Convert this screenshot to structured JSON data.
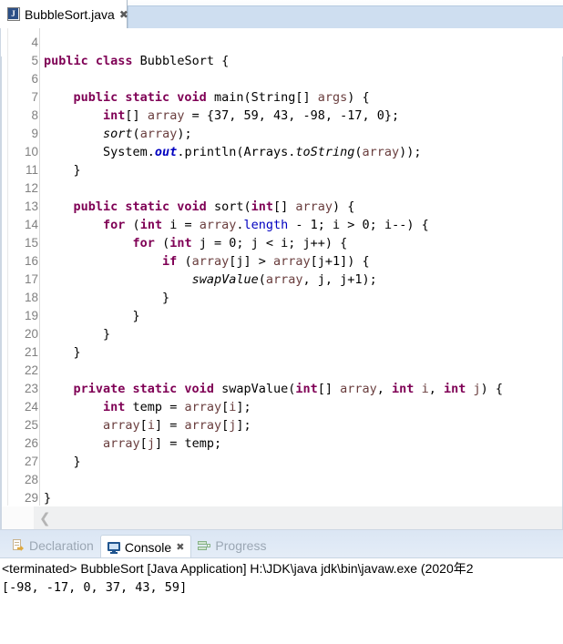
{
  "editor": {
    "tab": {
      "title": "BubbleSort.java",
      "close_glyph": "✖",
      "icon": "java-file-icon",
      "badge": "J"
    },
    "first_line_number": 4,
    "lines": [
      {
        "n": 4,
        "fold": false,
        "tokens": []
      },
      {
        "n": 5,
        "fold": false,
        "tokens": [
          {
            "t": "kw",
            "s": "public class"
          },
          {
            "t": "plain",
            "s": " BubbleSort {"
          }
        ]
      },
      {
        "n": 6,
        "fold": false,
        "tokens": []
      },
      {
        "n": 7,
        "fold": true,
        "tokens": [
          {
            "t": "plain",
            "s": "    "
          },
          {
            "t": "kw",
            "s": "public static void"
          },
          {
            "t": "plain",
            "s": " main(String[] "
          },
          {
            "t": "prm",
            "s": "args"
          },
          {
            "t": "plain",
            "s": ") {"
          }
        ]
      },
      {
        "n": 8,
        "fold": false,
        "tokens": [
          {
            "t": "plain",
            "s": "        "
          },
          {
            "t": "kw",
            "s": "int"
          },
          {
            "t": "plain",
            "s": "[] "
          },
          {
            "t": "prm",
            "s": "array"
          },
          {
            "t": "plain",
            "s": " = {37, 59, 43, -98, -17, 0};"
          }
        ]
      },
      {
        "n": 9,
        "fold": false,
        "tokens": [
          {
            "t": "plain",
            "s": "        "
          },
          {
            "t": "sm",
            "s": "sort"
          },
          {
            "t": "plain",
            "s": "("
          },
          {
            "t": "prm",
            "s": "array"
          },
          {
            "t": "plain",
            "s": ");"
          }
        ]
      },
      {
        "n": 10,
        "fold": false,
        "tokens": [
          {
            "t": "plain",
            "s": "        System."
          },
          {
            "t": "stat",
            "s": "out"
          },
          {
            "t": "plain",
            "s": ".println(Arrays."
          },
          {
            "t": "sm",
            "s": "toString"
          },
          {
            "t": "plain",
            "s": "("
          },
          {
            "t": "prm",
            "s": "array"
          },
          {
            "t": "plain",
            "s": "));"
          }
        ]
      },
      {
        "n": 11,
        "fold": false,
        "tokens": [
          {
            "t": "plain",
            "s": "    }"
          }
        ]
      },
      {
        "n": 12,
        "fold": false,
        "tokens": []
      },
      {
        "n": 13,
        "fold": true,
        "tokens": [
          {
            "t": "plain",
            "s": "    "
          },
          {
            "t": "kw",
            "s": "public static void"
          },
          {
            "t": "plain",
            "s": " sort("
          },
          {
            "t": "kw",
            "s": "int"
          },
          {
            "t": "plain",
            "s": "[] "
          },
          {
            "t": "prm",
            "s": "array"
          },
          {
            "t": "plain",
            "s": ") {"
          }
        ]
      },
      {
        "n": 14,
        "fold": false,
        "tokens": [
          {
            "t": "plain",
            "s": "        "
          },
          {
            "t": "kw",
            "s": "for"
          },
          {
            "t": "plain",
            "s": " ("
          },
          {
            "t": "kw",
            "s": "int"
          },
          {
            "t": "plain",
            "s": " i = "
          },
          {
            "t": "prm",
            "s": "array"
          },
          {
            "t": "plain",
            "s": "."
          },
          {
            "t": "fld",
            "s": "length"
          },
          {
            "t": "plain",
            "s": " - 1; i > 0; i--) {"
          }
        ]
      },
      {
        "n": 15,
        "fold": false,
        "tokens": [
          {
            "t": "plain",
            "s": "            "
          },
          {
            "t": "kw",
            "s": "for"
          },
          {
            "t": "plain",
            "s": " ("
          },
          {
            "t": "kw",
            "s": "int"
          },
          {
            "t": "plain",
            "s": " j = 0; j < i; j++) {"
          }
        ]
      },
      {
        "n": 16,
        "fold": false,
        "tokens": [
          {
            "t": "plain",
            "s": "                "
          },
          {
            "t": "kw",
            "s": "if"
          },
          {
            "t": "plain",
            "s": " ("
          },
          {
            "t": "prm",
            "s": "array"
          },
          {
            "t": "plain",
            "s": "[j] > "
          },
          {
            "t": "prm",
            "s": "array"
          },
          {
            "t": "plain",
            "s": "[j+1]) {"
          }
        ]
      },
      {
        "n": 17,
        "fold": false,
        "tokens": [
          {
            "t": "plain",
            "s": "                    "
          },
          {
            "t": "sm",
            "s": "swapValue"
          },
          {
            "t": "plain",
            "s": "("
          },
          {
            "t": "prm",
            "s": "array"
          },
          {
            "t": "plain",
            "s": ", j, j+1);"
          }
        ]
      },
      {
        "n": 18,
        "fold": false,
        "tokens": [
          {
            "t": "plain",
            "s": "                }"
          }
        ]
      },
      {
        "n": 19,
        "fold": false,
        "tokens": [
          {
            "t": "plain",
            "s": "            }"
          }
        ]
      },
      {
        "n": 20,
        "fold": false,
        "tokens": [
          {
            "t": "plain",
            "s": "        }"
          }
        ]
      },
      {
        "n": 21,
        "fold": false,
        "tokens": [
          {
            "t": "plain",
            "s": "    }"
          }
        ]
      },
      {
        "n": 22,
        "fold": false,
        "tokens": []
      },
      {
        "n": 23,
        "fold": true,
        "tokens": [
          {
            "t": "plain",
            "s": "    "
          },
          {
            "t": "kw",
            "s": "private static void"
          },
          {
            "t": "plain",
            "s": " swapValue("
          },
          {
            "t": "kw",
            "s": "int"
          },
          {
            "t": "plain",
            "s": "[] "
          },
          {
            "t": "prm",
            "s": "array"
          },
          {
            "t": "plain",
            "s": ", "
          },
          {
            "t": "kw",
            "s": "int"
          },
          {
            "t": "plain",
            "s": " "
          },
          {
            "t": "prm",
            "s": "i"
          },
          {
            "t": "plain",
            "s": ", "
          },
          {
            "t": "kw",
            "s": "int"
          },
          {
            "t": "plain",
            "s": " "
          },
          {
            "t": "prm",
            "s": "j"
          },
          {
            "t": "plain",
            "s": ") {"
          }
        ]
      },
      {
        "n": 24,
        "fold": false,
        "tokens": [
          {
            "t": "plain",
            "s": "        "
          },
          {
            "t": "kw",
            "s": "int"
          },
          {
            "t": "plain",
            "s": " temp = "
          },
          {
            "t": "prm",
            "s": "array"
          },
          {
            "t": "plain",
            "s": "["
          },
          {
            "t": "prm",
            "s": "i"
          },
          {
            "t": "plain",
            "s": "];"
          }
        ]
      },
      {
        "n": 25,
        "fold": false,
        "tokens": [
          {
            "t": "plain",
            "s": "        "
          },
          {
            "t": "prm",
            "s": "array"
          },
          {
            "t": "plain",
            "s": "["
          },
          {
            "t": "prm",
            "s": "i"
          },
          {
            "t": "plain",
            "s": "] = "
          },
          {
            "t": "prm",
            "s": "array"
          },
          {
            "t": "plain",
            "s": "["
          },
          {
            "t": "prm",
            "s": "j"
          },
          {
            "t": "plain",
            "s": "];"
          }
        ]
      },
      {
        "n": 26,
        "fold": false,
        "tokens": [
          {
            "t": "plain",
            "s": "        "
          },
          {
            "t": "prm",
            "s": "array"
          },
          {
            "t": "plain",
            "s": "["
          },
          {
            "t": "prm",
            "s": "j"
          },
          {
            "t": "plain",
            "s": "] = temp;"
          }
        ]
      },
      {
        "n": 27,
        "fold": false,
        "tokens": [
          {
            "t": "plain",
            "s": "    }"
          }
        ]
      },
      {
        "n": 28,
        "fold": false,
        "tokens": []
      },
      {
        "n": 29,
        "fold": false,
        "tokens": [
          {
            "t": "plain",
            "s": "}"
          }
        ]
      }
    ],
    "hscroll": {
      "left_arrow": "❮"
    }
  },
  "bottom": {
    "tabs": [
      {
        "label": "Declaration",
        "icon": "declaration-icon",
        "active": false,
        "closable": false
      },
      {
        "label": "Console",
        "icon": "console-icon",
        "active": true,
        "closable": true,
        "close_glyph": "✖"
      },
      {
        "label": "Progress",
        "icon": "progress-icon",
        "active": false,
        "closable": false
      }
    ],
    "console": {
      "header": "<terminated> BubbleSort [Java Application] H:\\JDK\\java  jdk\\bin\\javaw.exe (2020年2",
      "output": "[-98, -17, 0, 37, 43, 59]"
    }
  },
  "colors": {
    "keyword": "#7f0055",
    "field": "#0000c0",
    "parameter": "#6a3e3e",
    "plain": "#000000",
    "tab_active_bg": "#ffffff",
    "tabfolder_bg": "#cedef0"
  }
}
